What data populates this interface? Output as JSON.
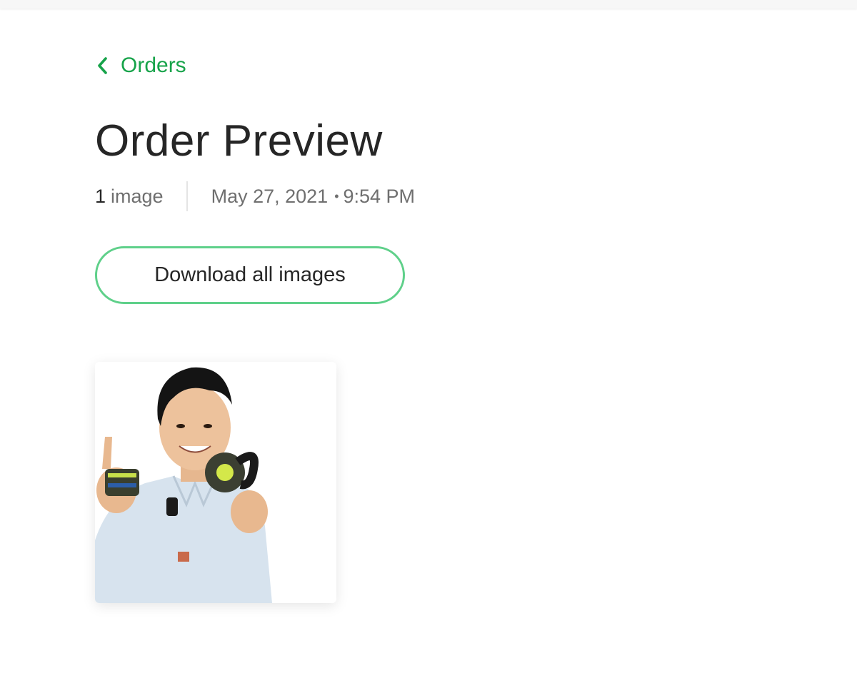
{
  "header": {
    "back_label": "Orders",
    "title": "Order Preview"
  },
  "meta": {
    "image_count": "1",
    "image_count_unit": "image",
    "date": "May 27, 2021",
    "separator": "•",
    "time": "9:54 PM"
  },
  "actions": {
    "download_all_label": "Download all images"
  },
  "images": [
    {
      "subject": "man holding product parts"
    }
  ],
  "colors": {
    "accent": "#17a34a",
    "button_border": "#5fd08a",
    "text_primary": "#262626",
    "text_secondary": "#6f6f6f",
    "divider": "#e4e4e4"
  },
  "icons": {
    "back": "chevron-left-icon"
  }
}
